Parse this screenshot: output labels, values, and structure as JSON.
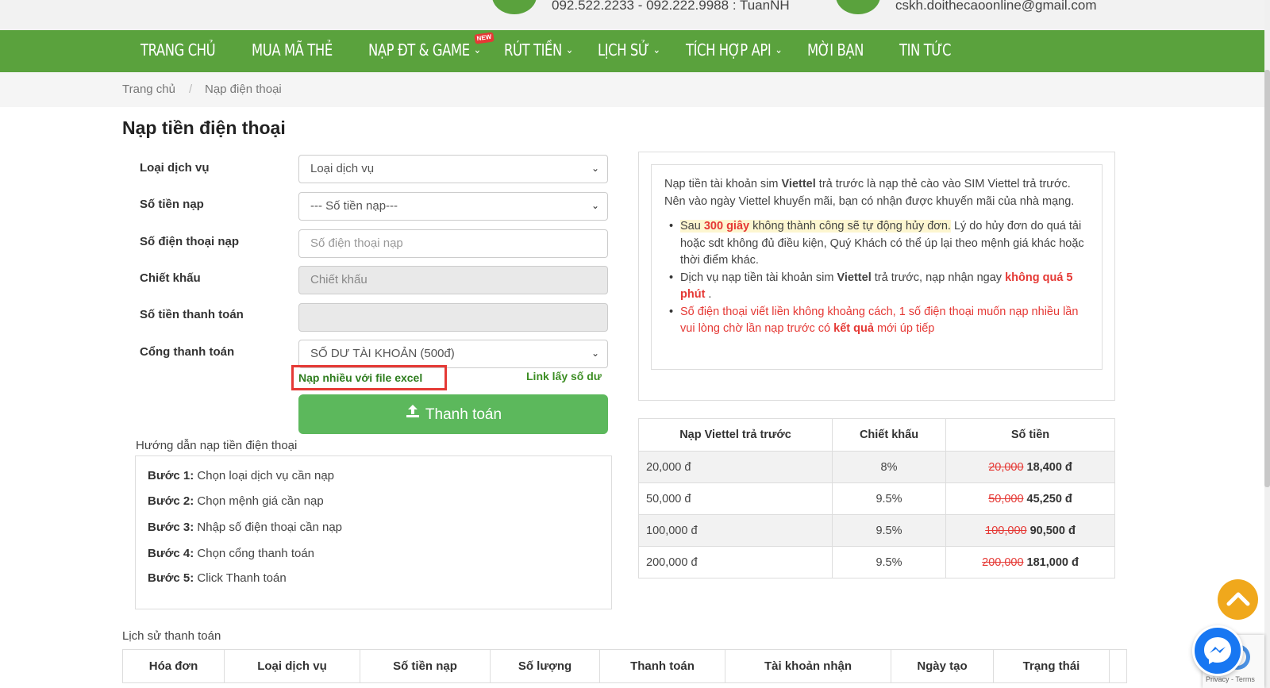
{
  "topbar": {
    "phones": "092.522.2233 - 092.222.9988 : TuanNH",
    "email": "cskh.doithecaoonline@gmail.com"
  },
  "nav": {
    "items": [
      {
        "label": "TRANG CHỦ",
        "dropdown": false
      },
      {
        "label": "MUA MÃ THẺ",
        "dropdown": false
      },
      {
        "label": "NẠP ĐT & GAME",
        "dropdown": true
      },
      {
        "label": "RÚT TIỀN",
        "dropdown": true
      },
      {
        "label": "LỊCH SỬ",
        "dropdown": true
      },
      {
        "label": "TÍCH HỢP API",
        "dropdown": true
      },
      {
        "label": "MỜI BẠN",
        "dropdown": false
      },
      {
        "label": "TIN TỨC",
        "dropdown": false
      }
    ],
    "new_badge": "NEW"
  },
  "breadcrumb": {
    "home": "Trang chủ",
    "separator": "/",
    "current": "Nạp điện thoại"
  },
  "page_title": "Nạp tiền điện thoại",
  "form": {
    "service_label": "Loại dịch vụ",
    "service_value": "Loại dịch vụ",
    "amount_label": "Số tiền nạp",
    "amount_value": "--- Số tiền nạp---",
    "phone_label": "Số điện thoại nạp",
    "phone_placeholder": "Số điện thoại nạp",
    "discount_label": "Chiết khấu",
    "discount_placeholder": "Chiết khấu",
    "payment_amount_label": "Số tiền thanh toán",
    "gateway_label": "Cổng thanh toán",
    "gateway_value": "SỐ DƯ TÀI KHOẢN (500đ)",
    "excel_link": "Nạp nhiều với file excel",
    "balance_link": "Link lấy số dư",
    "pay_button": "Thanh toán"
  },
  "guide": {
    "title": "Hướng dẫn nạp tiền điện thoại",
    "steps": [
      {
        "label": "Bước 1:",
        "text": "Chọn loại dịch vụ cần nạp"
      },
      {
        "label": "Bước 2:",
        "text": "Chọn mệnh giá cần nạp"
      },
      {
        "label": "Bước 3:",
        "text": "Nhập số điện thoại cần nạp"
      },
      {
        "label": "Bước 4:",
        "text": "Chọn cổng thanh toán"
      },
      {
        "label": "Bước 5:",
        "text": "Click Thanh toán"
      }
    ]
  },
  "info": {
    "intro_1": "Nạp tiền tài khoản sim ",
    "intro_brand": "Viettel",
    "intro_2": " trả trước là nạp thẻ cào vào SIM Viettel trả trước. Nên vào ngày Viettel khuyến mãi, bạn có nhận được khuyến mãi của nhà mạng.",
    "b1_pre": "Sau ",
    "b1_time": "300 giây",
    "b1_mid": " không thành công sẽ tự động hủy đơn.",
    "b1_post": " Lý do hủy đơn do quá tải hoặc sdt không đủ điều kiện, Quý Khách có thể úp lại theo mệnh giá khác hoặc thời điểm khác.",
    "b2_pre": "Dịch vụ nạp tiền tài khoản sim ",
    "b2_brand": "Viettel",
    "b2_mid": " trả trước, nạp nhận ngay ",
    "b2_red": "không quá 5 phút",
    "b2_post": " .",
    "b3_pre": "Số điện thoại viết liền không khoảng cách, 1 số điện thoại muốn nạp nhiều lần vui lòng chờ lần nạp trước có ",
    "b3_bold": "kết quả",
    "b3_post": " mới úp tiếp"
  },
  "price_table": {
    "headers": [
      "Nạp Viettel trả trước",
      "Chiết khấu",
      "Số tiền"
    ],
    "rows": [
      {
        "value": "20,000 đ",
        "discount": "8%",
        "original": "20,000",
        "final": "18,400 đ"
      },
      {
        "value": "50,000 đ",
        "discount": "9.5%",
        "original": "50,000",
        "final": "45,250 đ"
      },
      {
        "value": "100,000 đ",
        "discount": "9.5%",
        "original": "100,000",
        "final": "90,500 đ"
      },
      {
        "value": "200,000 đ",
        "discount": "9.5%",
        "original": "200,000",
        "final": "181,000 đ"
      }
    ]
  },
  "history": {
    "title": "Lịch sử thanh toán",
    "headers": [
      "Hóa đơn",
      "Loại dịch vụ",
      "Số tiền nạp",
      "Số lượng",
      "Thanh toán",
      "Tài khoản nhận",
      "Ngày tạo",
      "Trạng thái"
    ]
  },
  "recaptcha": {
    "text": "Privacy - Terms"
  },
  "colors": {
    "brand_green": "#5aa23d",
    "button_green": "#5cb85c",
    "accent_red": "#e53935",
    "backtop_orange": "#f0a81c",
    "messenger_blue": "#1877f2"
  },
  "icons": {
    "dropdown": "chevron-down-icon",
    "upload": "upload-icon",
    "backtop": "chevron-up-icon",
    "messenger": "messenger-icon"
  }
}
